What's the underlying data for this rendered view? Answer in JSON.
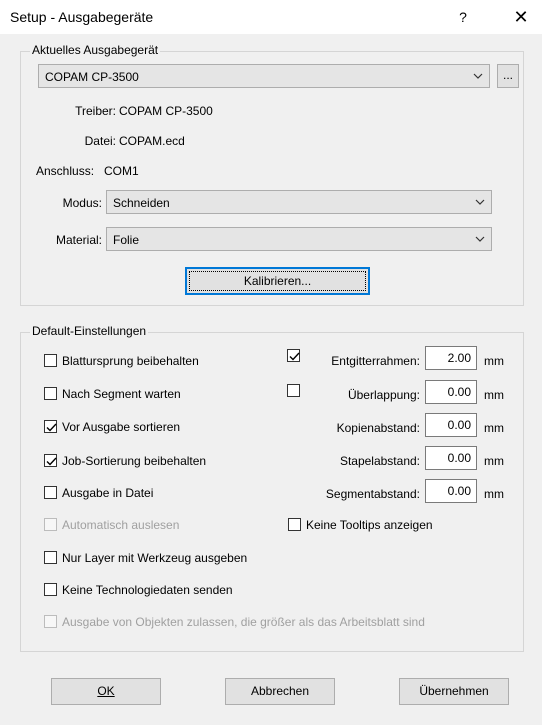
{
  "window": {
    "title": "Setup - Ausgabegeräte",
    "help_label": "?",
    "close_label": "✕"
  },
  "output_device": {
    "group_title": "Aktuelles Ausgabegerät",
    "device": "COPAM CP-3500",
    "browse_label": "...",
    "driver_label": "Treiber:",
    "driver_value": "COPAM CP-3500",
    "file_label": "Datei:",
    "file_value": "COPAM.ecd",
    "port_label": "Anschluss:",
    "port_value": "COM1",
    "mode_label": "Modus:",
    "mode_value": "Schneiden",
    "material_label": "Material:",
    "material_value": "Folie",
    "calibrate_label": "Kalibrieren..."
  },
  "defaults": {
    "group_title": "Default-Einstellungen",
    "checkboxes": [
      {
        "label": "Blattursprung beibehalten",
        "checked": false,
        "enabled": true
      },
      {
        "label": "Nach Segment warten",
        "checked": false,
        "enabled": true
      },
      {
        "label": "Vor Ausgabe sortieren",
        "checked": true,
        "enabled": true
      },
      {
        "label": "Job-Sortierung beibehalten",
        "checked": true,
        "enabled": true
      },
      {
        "label": "Ausgabe in Datei",
        "checked": false,
        "enabled": true
      },
      {
        "label": "Automatisch auslesen",
        "checked": false,
        "enabled": false
      },
      {
        "label": "Nur Layer mit Werkzeug ausgeben",
        "checked": false,
        "enabled": true
      },
      {
        "label": "Keine Technologiedaten senden",
        "checked": false,
        "enabled": true
      },
      {
        "label": "Ausgabe von Objekten zulassen, die größer als das Arbeitsblatt sind",
        "checked": false,
        "enabled": false
      }
    ],
    "grid_frame": {
      "label": "Entgitterrahmen:",
      "checked": true,
      "value": "2.00",
      "unit": "mm"
    },
    "overlap": {
      "label": "Überlappung:",
      "checked": false,
      "value": "0.00",
      "unit": "mm"
    },
    "copy_distance": {
      "label": "Kopienabstand:",
      "value": "0.00",
      "unit": "mm"
    },
    "stack_distance": {
      "label": "Stapelabstand:",
      "value": "0.00",
      "unit": "mm"
    },
    "segment_distance": {
      "label": "Segmentabstand:",
      "value": "0.00",
      "unit": "mm"
    },
    "no_tooltips": {
      "label": "Keine Tooltips anzeigen",
      "checked": false
    }
  },
  "footer": {
    "ok_label": "OK",
    "cancel_label": "Abbrechen",
    "apply_label": "Übernehmen"
  }
}
